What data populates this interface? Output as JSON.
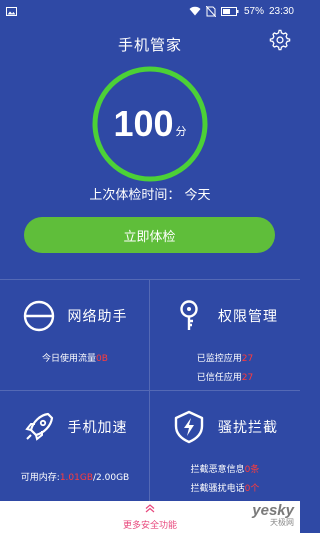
{
  "status_bar": {
    "battery": "57%",
    "time": "23:30"
  },
  "header": {
    "title": "手机管家"
  },
  "score": {
    "value": "100",
    "unit": "分"
  },
  "last_check": {
    "text": "上次体检时间： 今天"
  },
  "check_button": {
    "label": "立即体检"
  },
  "tiles": [
    {
      "title": "网络助手",
      "lines": [
        {
          "label": "今日使用流量",
          "value": "0B"
        }
      ]
    },
    {
      "title": "权限管理",
      "lines": [
        {
          "label": "已监控应用",
          "value": "27"
        },
        {
          "label": "已信任应用",
          "value": "27"
        }
      ]
    },
    {
      "title": "手机加速",
      "lines": [
        {
          "label": "可用内存:",
          "value": "1.01GB",
          "suffix": "/2.00GB"
        }
      ]
    },
    {
      "title": "骚扰拦截",
      "lines": [
        {
          "label": "拦截恶意信息",
          "value": "0条"
        },
        {
          "label": "拦截骚扰电话",
          "value": "0个"
        }
      ]
    }
  ],
  "bottom_bar": {
    "label": "更多安全功能"
  },
  "watermark": {
    "main": "yesky",
    "sub": "天极网"
  },
  "colors": {
    "background": "#2f49a5",
    "accent_green": "#5fbe3a",
    "ring_green": "#4cd137",
    "value_red": "#ff3b3b",
    "bottom_pink": "#e8487d"
  },
  "icons": [
    "image-icon",
    "wifi-icon",
    "no-sim-icon",
    "battery-icon",
    "gear-icon",
    "network-icon",
    "key-icon",
    "rocket-icon",
    "shield-lightning-icon",
    "chevron-up-icon"
  ]
}
